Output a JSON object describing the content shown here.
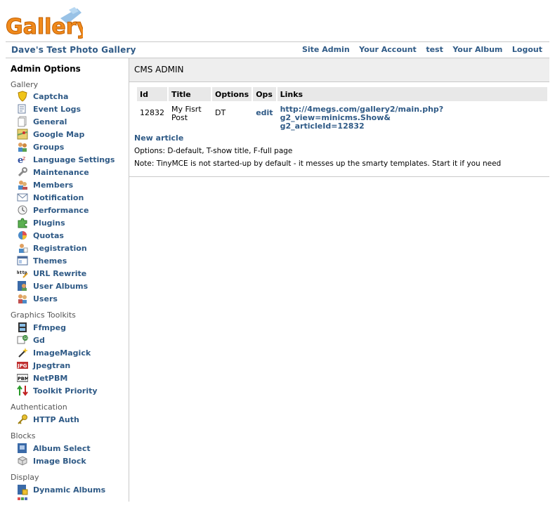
{
  "logo": {
    "text": "Gallery"
  },
  "header": {
    "gallery_title": "Dave's Test Photo Gallery",
    "links": [
      "Site Admin",
      "Your Account",
      "test",
      "Your Album",
      "Logout"
    ]
  },
  "sidebar": {
    "title": "Admin Options",
    "groups": [
      {
        "title": "Gallery",
        "items": [
          {
            "label": "Captcha",
            "icon": "shield-icon"
          },
          {
            "label": "Event Logs",
            "icon": "log-icon"
          },
          {
            "label": "General",
            "icon": "pages-icon"
          },
          {
            "label": "Google Map",
            "icon": "map-icon"
          },
          {
            "label": "Groups",
            "icon": "group-icon"
          },
          {
            "label": "Language Settings",
            "icon": "language-icon"
          },
          {
            "label": "Maintenance",
            "icon": "wrench-icon"
          },
          {
            "label": "Members",
            "icon": "members-icon"
          },
          {
            "label": "Notification",
            "icon": "envelope-icon"
          },
          {
            "label": "Performance",
            "icon": "clock-icon"
          },
          {
            "label": "Plugins",
            "icon": "puzzle-icon"
          },
          {
            "label": "Quotas",
            "icon": "pie-icon"
          },
          {
            "label": "Registration",
            "icon": "registration-icon"
          },
          {
            "label": "Themes",
            "icon": "window-icon"
          },
          {
            "label": "URL Rewrite",
            "icon": "url-rewrite-icon"
          },
          {
            "label": "User Albums",
            "icon": "user-album-icon"
          },
          {
            "label": "Users",
            "icon": "users-icon"
          }
        ]
      },
      {
        "title": "Graphics Toolkits",
        "items": [
          {
            "label": "Ffmpeg",
            "icon": "film-icon"
          },
          {
            "label": "Gd",
            "icon": "gd-icon"
          },
          {
            "label": "ImageMagick",
            "icon": "wand-icon"
          },
          {
            "label": "Jpegtran",
            "icon": "jpg-icon"
          },
          {
            "label": "NetPBM",
            "icon": "pbm-icon"
          },
          {
            "label": "Toolkit Priority",
            "icon": "priority-arrows-icon"
          }
        ]
      },
      {
        "title": "Authentication",
        "items": [
          {
            "label": "HTTP Auth",
            "icon": "key-icon"
          }
        ]
      },
      {
        "title": "Blocks",
        "items": [
          {
            "label": "Album Select",
            "icon": "album-select-icon"
          },
          {
            "label": "Image Block",
            "icon": "block-icon"
          }
        ]
      },
      {
        "title": "Display",
        "items": [
          {
            "label": "Dynamic Albums",
            "icon": "dynamic-album-icon"
          }
        ]
      }
    ]
  },
  "main": {
    "title": "CMS ADMIN",
    "table": {
      "headers": [
        "Id",
        "Title",
        "Options",
        "Ops",
        "Links"
      ],
      "rows": [
        {
          "id": "12832",
          "title_line1": "My Fisrt",
          "title_line2": "Post",
          "options": "DT",
          "ops": "edit",
          "link_line1": "http://4megs.com/gallery2/main.php?g2_view=minicms.Show&",
          "link_line2": "g2_articleId=12832"
        }
      ]
    },
    "new_article": "New article",
    "options_note": "Options: D-default, T-show title, F-full page",
    "tiny_note": "Note: TinyMCE is not started-up by default - it messes up the smarty templates. Start it if you need"
  }
}
